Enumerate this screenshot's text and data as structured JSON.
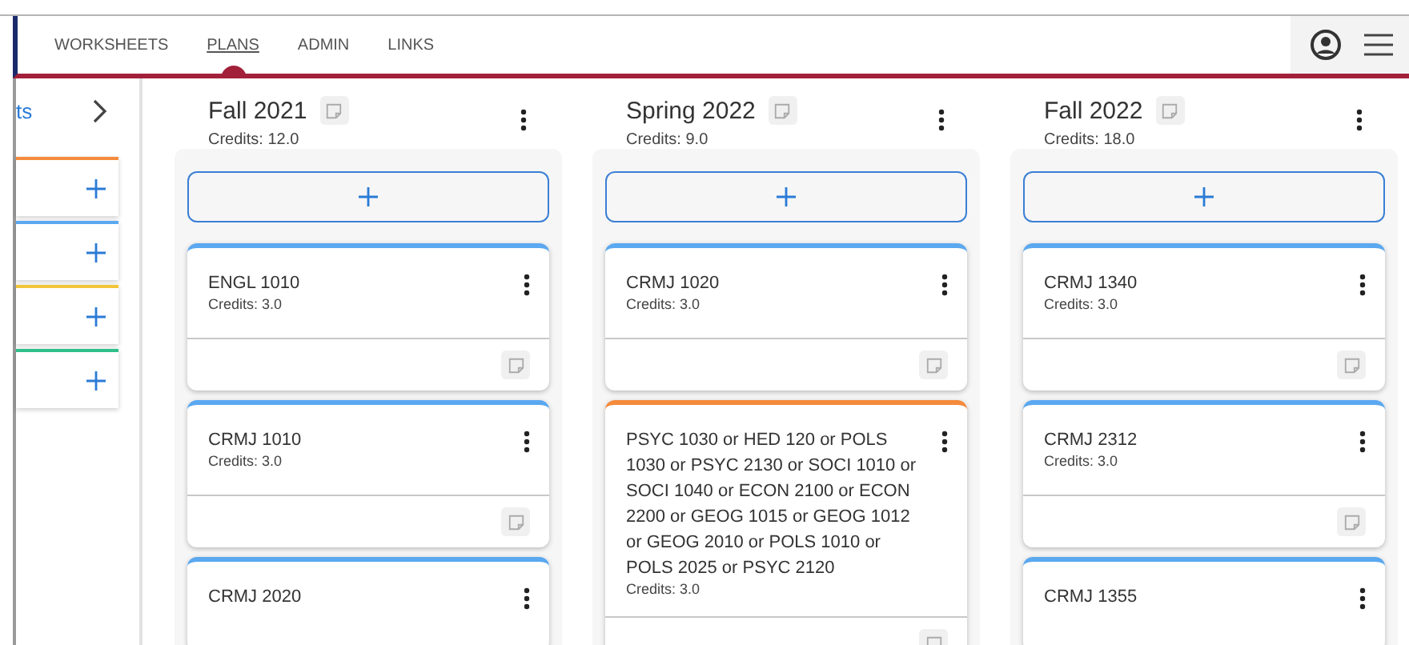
{
  "nav": {
    "tabs": [
      {
        "label": "WORKSHEETS",
        "selected": false
      },
      {
        "label": "PLANS",
        "selected": true
      },
      {
        "label": "ADMIN",
        "selected": false
      },
      {
        "label": "LINKS",
        "selected": false
      }
    ]
  },
  "sidebar": {
    "title": "ts",
    "groups": [
      {
        "color": "#f58a3c"
      },
      {
        "color": "#5aa8f0"
      },
      {
        "color": "#f2c53a"
      },
      {
        "color": "#2fbf8a"
      }
    ]
  },
  "terms": [
    {
      "title": "Fall 2021",
      "credits": "Credits:  12.0",
      "courses": [
        {
          "name": "ENGL 1010",
          "credits": "Credits: 3.0",
          "color": "#5aa8f0"
        },
        {
          "name": "CRMJ 1010",
          "credits": "Credits: 3.0",
          "color": "#5aa8f0"
        },
        {
          "name": "CRMJ 2020",
          "color": "#5aa8f0"
        }
      ]
    },
    {
      "title": "Spring 2022",
      "credits": "Credits:  9.0",
      "courses": [
        {
          "name": "CRMJ 1020",
          "credits": "Credits: 3.0",
          "color": "#5aa8f0"
        },
        {
          "name": "PSYC 1030 or HED 120 or POLS 1030 or PSYC 2130 or SOCI 1010 or SOCI 1040 or ECON 2100 or ECON 2200 or GEOG 1015 or GEOG 1012 or GEOG 2010 or POLS 1010 or POLS 2025 or PSYC 2120",
          "credits": "Credits: 3.0",
          "color": "#f58a3c"
        }
      ]
    },
    {
      "title": "Fall 2022",
      "credits": "Credits:  18.0",
      "courses": [
        {
          "name": "CRMJ 1340",
          "credits": "Credits: 3.0",
          "color": "#5aa8f0"
        },
        {
          "name": "CRMJ 2312",
          "credits": "Credits: 3.0",
          "color": "#5aa8f0"
        },
        {
          "name": "CRMJ 1355",
          "color": "#5aa8f0"
        }
      ]
    }
  ]
}
